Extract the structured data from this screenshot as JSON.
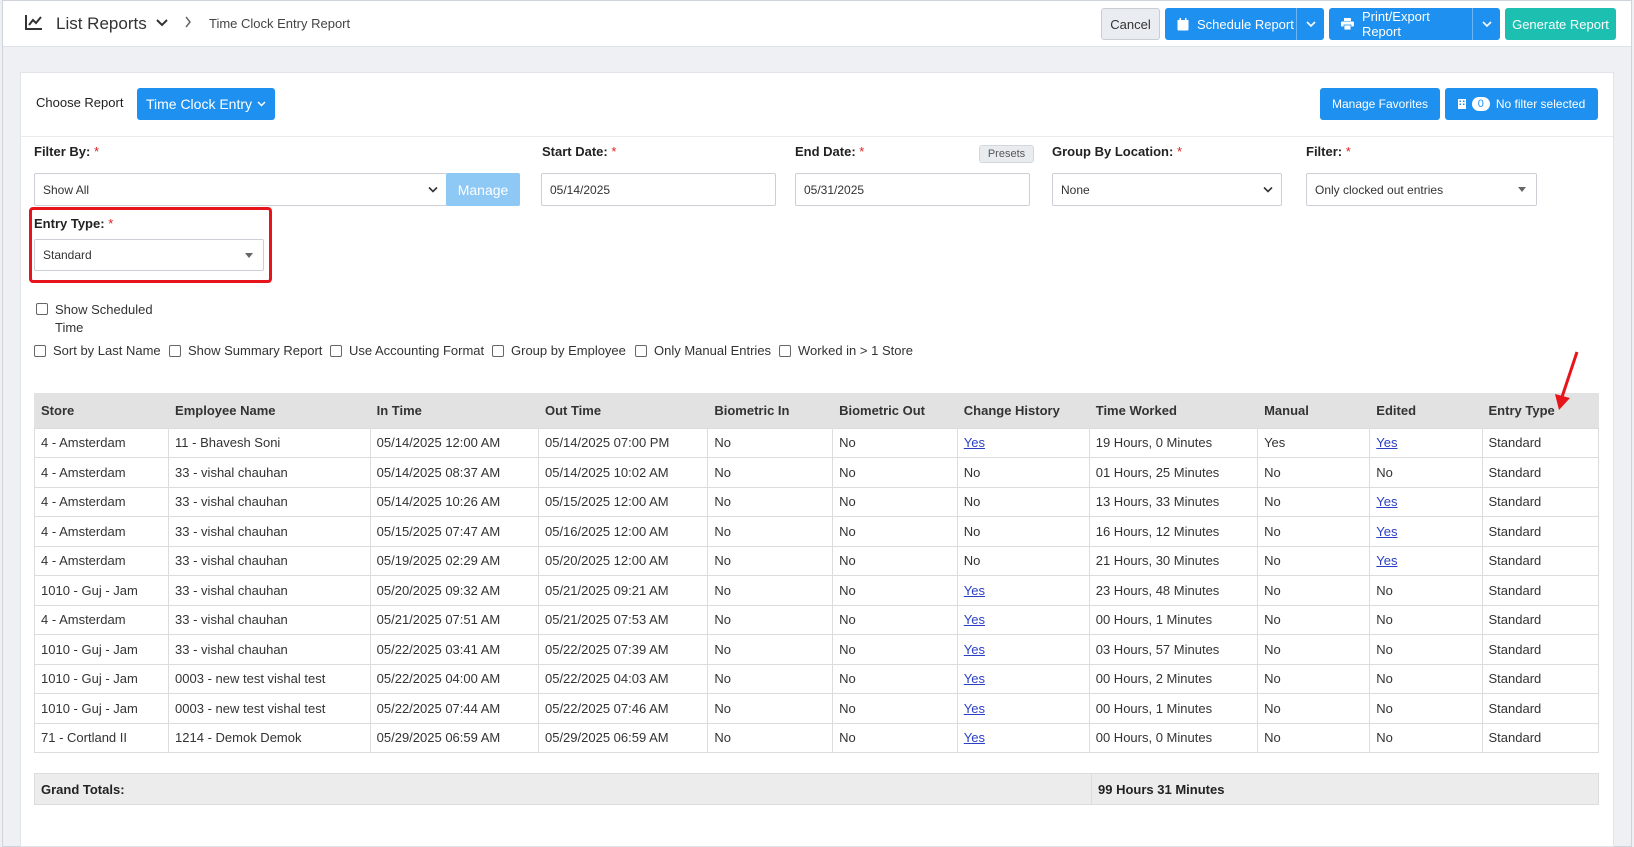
{
  "header": {
    "title": "List Reports",
    "breadcrumb": "Time Clock Entry Report",
    "cancel_label": "Cancel",
    "schedule_label": "Schedule Report",
    "print_label": "Print/Export Report",
    "generate_label": "Generate Report"
  },
  "panel": {
    "choose_label": "Choose Report",
    "report_selected": "Time Clock Entry",
    "favorites_label": "Manage Favorites",
    "filter_count": "0",
    "filter_status": "No filter selected"
  },
  "filters": {
    "filter_by_label": "Filter By:",
    "filter_by_value": "Show All",
    "manage_label": "Manage",
    "start_label": "Start Date:",
    "start_value": "05/14/2025",
    "end_label": "End Date:",
    "end_value": "05/31/2025",
    "presets_label": "Presets",
    "group_label": "Group By Location:",
    "group_value": "None",
    "filter_label": "Filter:",
    "filter_value": "Only clocked out entries",
    "entry_type_label": "Entry Type:",
    "entry_type_value": "Standard",
    "required_mark": "*"
  },
  "options": [
    "Show Scheduled Time",
    "Sort by Last Name",
    "Show Summary Report",
    "Use Accounting Format",
    "Group by Employee",
    "Only Manual Entries",
    "Worked in > 1 Store"
  ],
  "table": {
    "columns": [
      "Store",
      "Employee Name",
      "In Time",
      "Out Time",
      "Biometric In",
      "Biometric Out",
      "Change History",
      "Time Worked",
      "Manual",
      "Edited",
      "Entry Type"
    ],
    "rows": [
      [
        "4 - Amsterdam",
        "11 - Bhavesh Soni",
        "05/14/2025 12:00 AM",
        "05/14/2025 07:00 PM",
        "No",
        "No",
        "Yes",
        "19 Hours, 0 Minutes",
        "Yes",
        "Yes",
        "Standard"
      ],
      [
        "4 - Amsterdam",
        "33 - vishal chauhan",
        "05/14/2025 08:37 AM",
        "05/14/2025 10:02 AM",
        "No",
        "No",
        "No",
        "01 Hours, 25 Minutes",
        "No",
        "No",
        "Standard"
      ],
      [
        "4 - Amsterdam",
        "33 - vishal chauhan",
        "05/14/2025 10:26 AM",
        "05/15/2025 12:00 AM",
        "No",
        "No",
        "No",
        "13 Hours, 33 Minutes",
        "No",
        "Yes",
        "Standard"
      ],
      [
        "4 - Amsterdam",
        "33 - vishal chauhan",
        "05/15/2025 07:47 AM",
        "05/16/2025 12:00 AM",
        "No",
        "No",
        "No",
        "16 Hours, 12 Minutes",
        "No",
        "Yes",
        "Standard"
      ],
      [
        "4 - Amsterdam",
        "33 - vishal chauhan",
        "05/19/2025 02:29 AM",
        "05/20/2025 12:00 AM",
        "No",
        "No",
        "No",
        "21 Hours, 30 Minutes",
        "No",
        "Yes",
        "Standard"
      ],
      [
        "1010 - Guj - Jam",
        "33 - vishal chauhan",
        "05/20/2025 09:32 AM",
        "05/21/2025 09:21 AM",
        "No",
        "No",
        "Yes",
        "23 Hours, 48 Minutes",
        "No",
        "No",
        "Standard"
      ],
      [
        "4 - Amsterdam",
        "33 - vishal chauhan",
        "05/21/2025 07:51 AM",
        "05/21/2025 07:53 AM",
        "No",
        "No",
        "Yes",
        "00 Hours, 1 Minutes",
        "No",
        "No",
        "Standard"
      ],
      [
        "1010 - Guj - Jam",
        "33 - vishal chauhan",
        "05/22/2025 03:41 AM",
        "05/22/2025 07:39 AM",
        "No",
        "No",
        "Yes",
        "03 Hours, 57 Minutes",
        "No",
        "No",
        "Standard"
      ],
      [
        "1010 - Guj - Jam",
        "0003 - new test vishal test",
        "05/22/2025 04:00 AM",
        "05/22/2025 04:03 AM",
        "No",
        "No",
        "Yes",
        "00 Hours, 2 Minutes",
        "No",
        "No",
        "Standard"
      ],
      [
        "1010 - Guj - Jam",
        "0003 - new test vishal test",
        "05/22/2025 07:44 AM",
        "05/22/2025 07:46 AM",
        "No",
        "No",
        "Yes",
        "00 Hours, 1 Minutes",
        "No",
        "No",
        "Standard"
      ],
      [
        "71 - Cortland II",
        "1214 - Demok Demok",
        "05/29/2025 06:59 AM",
        "05/29/2025 06:59 AM",
        "No",
        "No",
        "Yes",
        "00 Hours, 0 Minutes",
        "No",
        "No",
        "Standard"
      ]
    ],
    "link_columns": [
      6,
      9
    ],
    "link_value": "Yes"
  },
  "totals": {
    "label": "Grand Totals:",
    "value": "99 Hours 31 Minutes"
  },
  "colors": {
    "primary": "#1e90f0",
    "generate": "#1dbfb0",
    "highlight": "#e8141c",
    "link": "#2a3fc6"
  }
}
